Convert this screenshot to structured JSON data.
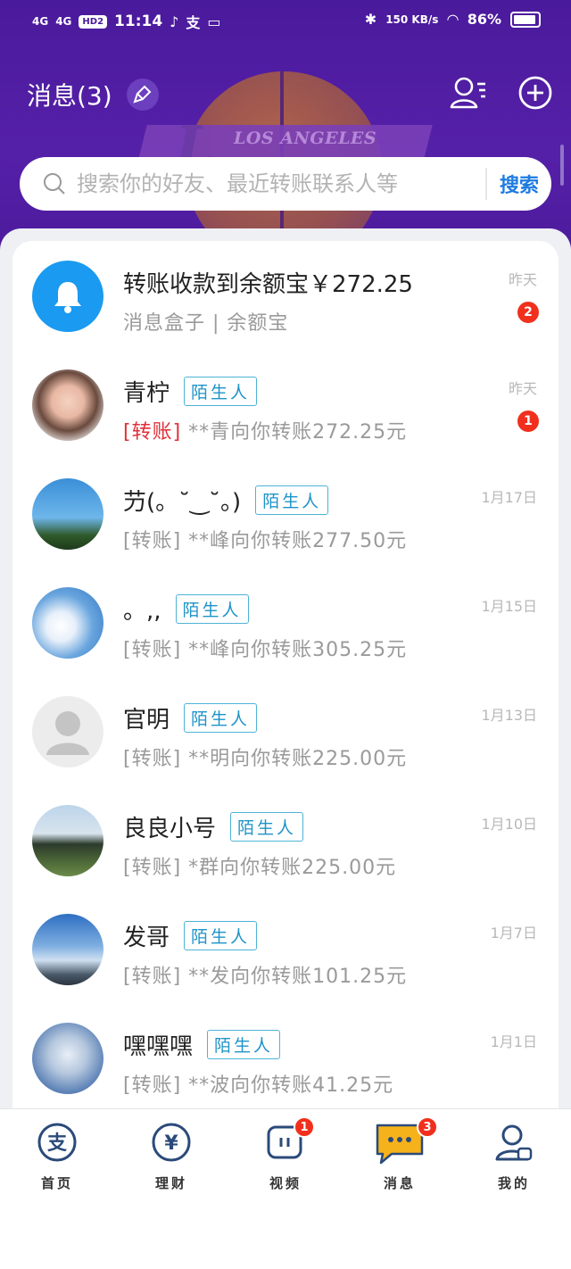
{
  "status_bar": {
    "network1": "4G",
    "network2": "4G",
    "hd": "HD2",
    "time": "11:14",
    "speed": "150 KB/s",
    "battery": "86%"
  },
  "header": {
    "title": "消息(3)",
    "logo_text": "LOS ANGELES"
  },
  "search": {
    "placeholder": "搜索你的好友、最近转账联系人等",
    "button": "搜索"
  },
  "messages": [
    {
      "name": "转账收款到余额宝￥272.25",
      "preview_tag": "",
      "preview": "消息盒子 | 余额宝",
      "date": "昨天",
      "badge": "2",
      "stranger": ""
    },
    {
      "name": "青柠",
      "preview_tag": "[转账]",
      "preview": "**青向你转账272.25元",
      "date": "昨天",
      "badge": "1",
      "stranger": "陌生人"
    },
    {
      "name": "芀(。˘‿˘。)",
      "preview_tag": "[转账]",
      "preview": "**峰向你转账277.50元",
      "date": "1月17日",
      "badge": "",
      "stranger": "陌生人"
    },
    {
      "name": "。,,",
      "preview_tag": "[转账]",
      "preview": "**峰向你转账305.25元",
      "date": "1月15日",
      "badge": "",
      "stranger": "陌生人"
    },
    {
      "name": "官明",
      "preview_tag": "[转账]",
      "preview": "**明向你转账225.00元",
      "date": "1月13日",
      "badge": "",
      "stranger": "陌生人"
    },
    {
      "name": "良良小号",
      "preview_tag": "[转账]",
      "preview": "*群向你转账225.00元",
      "date": "1月10日",
      "badge": "",
      "stranger": "陌生人"
    },
    {
      "name": "发哥",
      "preview_tag": "[转账]",
      "preview": "**发向你转账101.25元",
      "date": "1月7日",
      "badge": "",
      "stranger": "陌生人"
    },
    {
      "name": "嘿嘿嘿",
      "preview_tag": "[转账]",
      "preview": "**波向你转账41.25元",
      "date": "1月1日",
      "badge": "",
      "stranger": "陌生人"
    }
  ],
  "nav": [
    {
      "label": "首页",
      "badge": ""
    },
    {
      "label": "理财",
      "badge": ""
    },
    {
      "label": "视频",
      "badge": "1"
    },
    {
      "label": "消息",
      "badge": "3"
    },
    {
      "label": "我的",
      "badge": ""
    }
  ],
  "colors": {
    "header_bg": "#4a1a9c",
    "accent_blue": "#1e7be0",
    "badge_red": "#f0301d",
    "stranger_tag": "#1e93c8",
    "transfer_red": "#e0303a"
  }
}
